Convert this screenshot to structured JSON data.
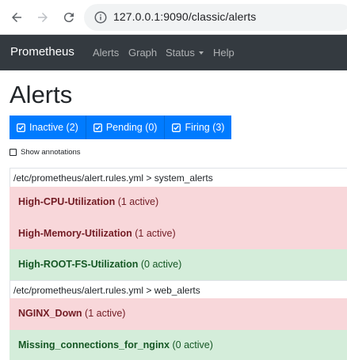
{
  "browser": {
    "url": "127.0.0.1:9090/classic/alerts"
  },
  "navbar": {
    "brand": "Prometheus",
    "links": [
      "Alerts",
      "Graph",
      "Status",
      "Help"
    ]
  },
  "page": {
    "title": "Alerts",
    "filters": [
      {
        "label": "Inactive (2)"
      },
      {
        "label": "Pending (0)"
      },
      {
        "label": "Firing (3)"
      }
    ],
    "show_annotations": "Show annotations"
  },
  "groups": [
    {
      "header": "/etc/prometheus/alert.rules.yml > system_alerts",
      "rules": [
        {
          "name": "High-CPU-Utilization",
          "status": "(1 active)",
          "state": "firing"
        },
        {
          "name": "High-Memory-Utilization",
          "status": "(1 active)",
          "state": "firing"
        },
        {
          "name": "High-ROOT-FS-Utilization",
          "status": "(0 active)",
          "state": "inactive"
        }
      ]
    },
    {
      "header": "/etc/prometheus/alert.rules.yml > web_alerts",
      "rules": [
        {
          "name": "NGINX_Down",
          "status": "(1 active)",
          "state": "firing"
        },
        {
          "name": "Missing_connections_for_nginx",
          "status": "(0 active)",
          "state": "inactive"
        }
      ]
    }
  ],
  "colors": {
    "navbar": "#343a40",
    "button": "#007bff",
    "firing_bg": "#f8d7da",
    "firing_text": "#721c24",
    "inactive_bg": "#d4edda",
    "inactive_text": "#155724"
  }
}
